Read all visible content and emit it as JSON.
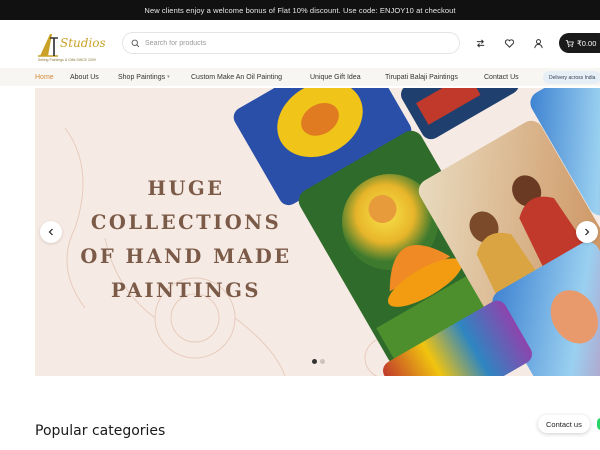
{
  "topbar": {
    "text": "New clients enjoy a welcome bonus of Flat 10% discount. Use code: ENJOY10 at checkout"
  },
  "header": {
    "logo_text": "Studios",
    "logo_tagline": "Selling Paintings & Gifts SINCE 2009",
    "search_placeholder": "Search for products",
    "cart_amount": "₹0.00",
    "icons": [
      "compare-icon",
      "wishlist-icon",
      "account-icon",
      "cart-icon"
    ]
  },
  "nav": {
    "items": [
      {
        "label": "Home",
        "active": true
      },
      {
        "label": "About Us"
      },
      {
        "label": "Shop Paintings",
        "has_caret": true
      },
      {
        "label": "Custom Make An Oil Painting"
      },
      {
        "label": "Unique Gift Idea"
      },
      {
        "label": "Tirupati Balaji Paintings"
      },
      {
        "label": "Contact Us"
      }
    ],
    "delivery_badge": "Delivery across India"
  },
  "hero": {
    "line1": "HUGE",
    "line2": "COLLECTIONS",
    "line3": "OF HAND MADE",
    "line4": "PAINTINGS",
    "slides": 2,
    "active_slide": 1
  },
  "sections": {
    "popular_title": "Popular categories"
  },
  "widgets": {
    "contact_label": "Contact us"
  },
  "colors": {
    "accent": "#d6893b",
    "topbar": "#111111",
    "hero_bg": "#f6ebe4",
    "hero_text": "#7b5a48"
  }
}
